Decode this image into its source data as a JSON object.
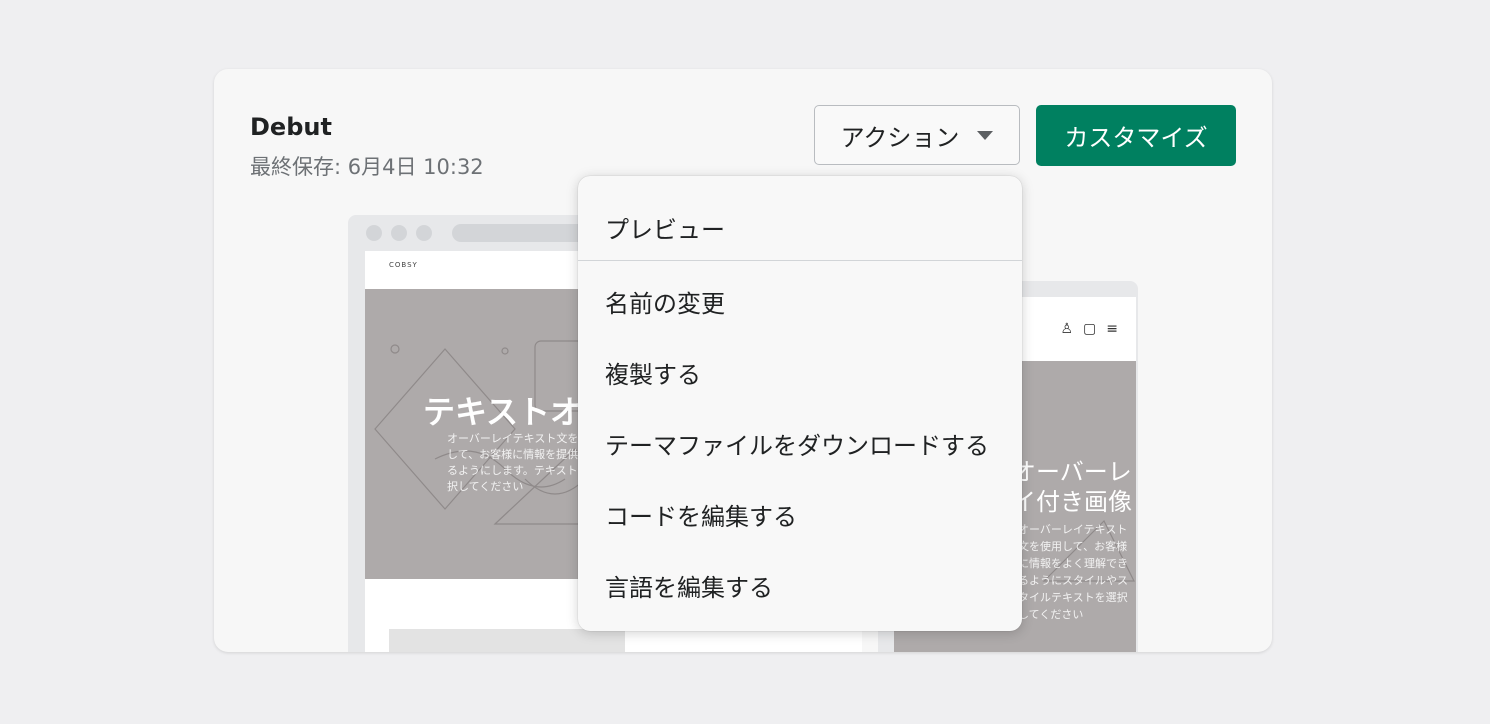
{
  "theme": {
    "name": "Debut",
    "last_saved": "最終保存: 6月4日 10:32"
  },
  "buttons": {
    "actions_label": "アクション",
    "customize_label": "カスタマイズ"
  },
  "preview": {
    "desktop": {
      "logo_text": "COBSY",
      "hero_title": "テキストオーバーレイ付き画像",
      "hero_subtitle": "オーバーレイテキスト文を使用して、お客様に情報を提供できるようにします。テキストを選択してください"
    },
    "mobile": {
      "hero_title_line1": "オーバーレ",
      "hero_title_line2": "イ付き画像",
      "hero_subtitle": "オーバーレイテキスト文を使用して、お客様に情報をよく理解できるようにスタイルやスタイルテキストを選択してください"
    }
  },
  "menu": {
    "items": [
      "プレビュー",
      "名前の変更",
      "複製する",
      "テーマファイルをダウンロードする",
      "コードを編集する",
      "言語を編集する"
    ]
  },
  "colors": {
    "primary": "#008060",
    "background": "#efeff1",
    "card": "#f7f7f7",
    "hero_gray": "#aeaaaa"
  }
}
